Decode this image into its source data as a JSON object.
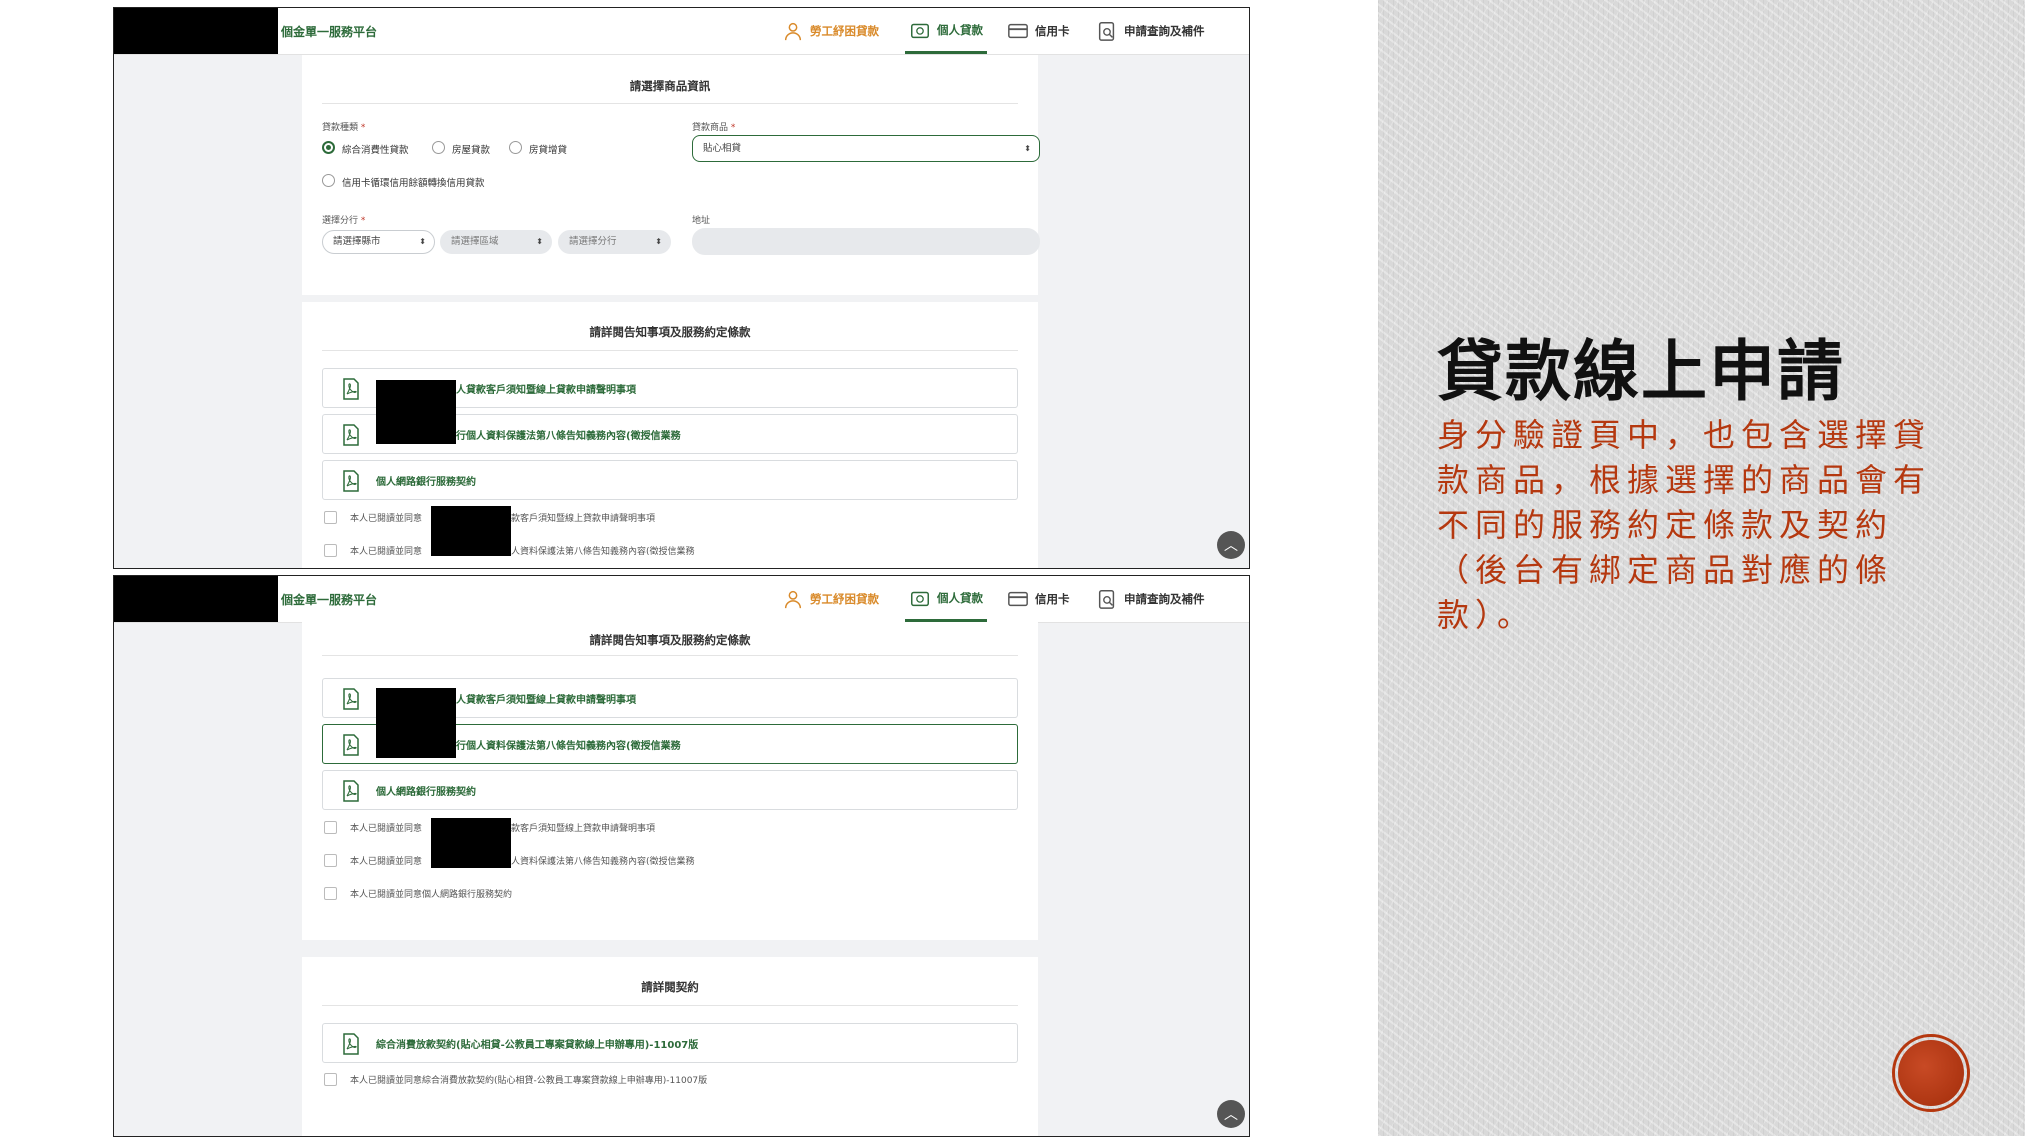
{
  "slide": {
    "title": "貸款線上申請",
    "body": "身分驗證頁中，也包含選擇貸款商品，根據選擇的商品會有不同的服務約定條款及契約（後台有綁定商品對應的條款）。"
  },
  "app": {
    "platform_title": "個金單一服務平台",
    "nav": {
      "labor": "勞工紓困貸款",
      "personal": "個人貸款",
      "card": "信用卡",
      "inquiry": "申請查詢及補件"
    }
  },
  "product": {
    "section_title": "請選擇商品資訊",
    "loan_type_label": "貸款種類",
    "loan_types": [
      "綜合消費性貸款",
      "房屋貸款",
      "房貸增貸",
      "信用卡循環信用餘額轉換信用貸款"
    ],
    "loan_product_label": "貸款商品",
    "loan_product_value": "貼心相貸",
    "branch_label": "選擇分行",
    "branch_city_placeholder": "請選擇縣市",
    "branch_district_placeholder": "請選擇區域",
    "branch_branch_placeholder": "請選擇分行",
    "address_label": "地址",
    "required_mark": "*"
  },
  "terms": {
    "section_title": "請詳閱告知事項及服務約定條款",
    "docs": [
      "人貸款客戶須知暨線上貸款申請聲明事項",
      "行個人資料保護法第八條告知義務內容(徵授信業務",
      "個人網路銀行服務契約"
    ],
    "agree": [
      "本人已閱讀並同意",
      "貸款客戶須知暨線上貸款申請聲明事項",
      "個人資料保護法第八條告知義務內容(徵授信業務",
      "本人已閱讀並同意個人網路銀行服務契約"
    ]
  },
  "contract": {
    "section_title": "請詳閱契約",
    "doc": "綜合消費放款契約(貼心相貸-公教員工專案貸款線上申辦專用)-11007版",
    "agree": "本人已閱讀並同意綜合消費放款契約(貼心相貸-公教員工專案貸款線上申辦專用)-11007版"
  },
  "colors": {
    "brand_green": "#2d6b3a",
    "accent_orange": "#d98a2a",
    "slide_red": "#b5380f"
  }
}
